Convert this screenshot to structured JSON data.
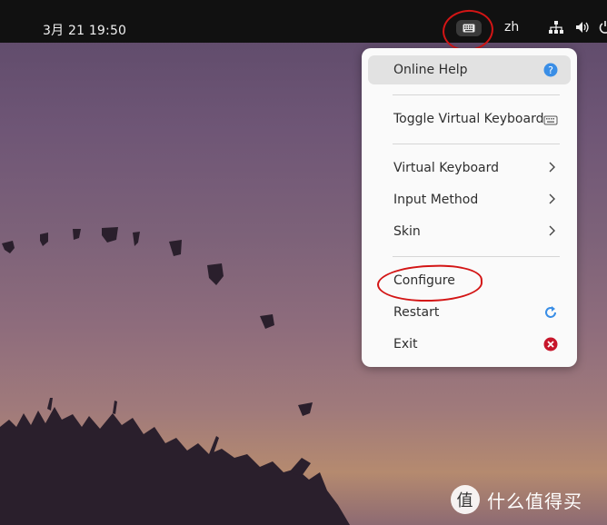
{
  "topbar": {
    "clock": "3月 21  19:50",
    "language": "zh",
    "icons": [
      "keyboard-icon",
      "network-icon",
      "volume-icon",
      "power-icon"
    ]
  },
  "menu": {
    "items": [
      {
        "label": "Online Help",
        "icon": "help-icon"
      },
      {
        "label": "Toggle Virtual Keyboard",
        "icon": "keyboard-icon"
      },
      {
        "label": "Virtual Keyboard",
        "icon": "chevron-right-icon"
      },
      {
        "label": "Input Method",
        "icon": "chevron-right-icon"
      },
      {
        "label": "Skin",
        "icon": "chevron-right-icon"
      },
      {
        "label": "Configure"
      },
      {
        "label": "Restart",
        "icon": "restart-icon"
      },
      {
        "label": "Exit",
        "icon": "exit-icon"
      }
    ]
  },
  "watermark": {
    "text": "什么值得买",
    "logo_glyph": "值"
  },
  "colors": {
    "annotation": "#d31515",
    "help_blue": "#3a8ee6",
    "exit_red": "#c7162b"
  }
}
